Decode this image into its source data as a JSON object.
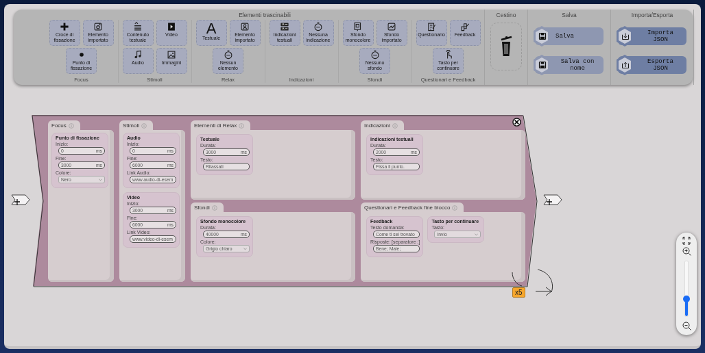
{
  "toolbar": {
    "palette": {
      "title": "Elementi trascinabili",
      "groups": [
        {
          "label": "Focus",
          "items": [
            {
              "label": "Croce di fissazione"
            },
            {
              "label": "Elemento importato"
            },
            {
              "label": "Punto di fissazione"
            }
          ]
        },
        {
          "label": "Stimoli",
          "items": [
            {
              "label": "Contenuto testuale"
            },
            {
              "label": "Video"
            },
            {
              "label": "Audio"
            },
            {
              "label": "Immagini"
            }
          ]
        },
        {
          "label": "Relax",
          "items": [
            {
              "label": "Testuale",
              "glyph": "A"
            },
            {
              "label": "Elemento importato"
            },
            {
              "label": "Nessun elemento"
            }
          ]
        },
        {
          "label": "Indicazioni",
          "items": [
            {
              "label": "Indicazioni testuali"
            },
            {
              "label": "Nessuna indicazione"
            }
          ]
        },
        {
          "label": "Sfondi",
          "items": [
            {
              "label": "Sfondo monocolore"
            },
            {
              "label": "Sfondo importato"
            },
            {
              "label": "Nessuno sfondo"
            }
          ]
        },
        {
          "label": "Questionari e Feedback",
          "items": [
            {
              "label": "Questionario"
            },
            {
              "label": "Feedback"
            },
            {
              "label": "Tasto per continuare"
            }
          ]
        }
      ]
    },
    "trash": {
      "title": "Cestino"
    },
    "save": {
      "title": "Salva",
      "buttons": [
        {
          "label": "Salva"
        },
        {
          "label": "Salva con nome"
        }
      ]
    },
    "import_export": {
      "title": "Importa/Esporta",
      "buttons": [
        {
          "label": "Importa JSON"
        },
        {
          "label": "Esporta JSON"
        }
      ]
    }
  },
  "block": {
    "repeat": "x5",
    "columns": [
      {
        "title": "Focus",
        "cards": [
          {
            "title": "Punto di fissazione",
            "fields": [
              {
                "label": "Inizio:",
                "kind": "number",
                "value": "0",
                "unit": "ms"
              },
              {
                "label": "Fine:",
                "kind": "number",
                "value": "3000",
                "unit": "ms"
              },
              {
                "label": "Colore:",
                "kind": "select",
                "value": "Nero"
              }
            ]
          }
        ]
      },
      {
        "title": "Stimoli",
        "cards": [
          {
            "title": "Audio",
            "fields": [
              {
                "label": "Inizio:",
                "kind": "number",
                "value": "0",
                "unit": "ms"
              },
              {
                "label": "Fine:",
                "kind": "number",
                "value": "6000",
                "unit": "ms"
              },
              {
                "label": "Link Audio:",
                "kind": "text",
                "value": "www.audio-di-esem"
              }
            ]
          },
          {
            "title": "Video",
            "fields": [
              {
                "label": "Inizio:",
                "kind": "number",
                "value": "3000",
                "unit": "ms"
              },
              {
                "label": "Fine:",
                "kind": "number",
                "value": "6000",
                "unit": "ms"
              },
              {
                "label": "Link Video:",
                "kind": "text",
                "value": "www.video-di-esem"
              }
            ]
          }
        ]
      }
    ],
    "panels": [
      {
        "title": "Elementi di Relax",
        "cards": [
          {
            "title": "Testuale",
            "fields": [
              {
                "label": "Durata:",
                "kind": "number",
                "value": "3000",
                "unit": "ms"
              },
              {
                "label": "Testo:",
                "kind": "text",
                "value": "Rilassati"
              }
            ]
          }
        ]
      },
      {
        "title": "Indicazioni",
        "cards": [
          {
            "title": "Indicazioni testuali",
            "fields": [
              {
                "label": "Durata:",
                "kind": "number",
                "value": "2000",
                "unit": "ms"
              },
              {
                "label": "Testo:",
                "kind": "text",
                "value": "Fissa il punto."
              }
            ]
          }
        ]
      },
      {
        "title": "Sfondi",
        "cards": [
          {
            "title": "Sfondo monocolore",
            "fields": [
              {
                "label": "Durata:",
                "kind": "number",
                "value": "40000",
                "unit": "ms"
              },
              {
                "label": "Colore:",
                "kind": "select",
                "value": "Grigio chiaro"
              }
            ]
          }
        ]
      },
      {
        "title": "Questionari e Feedback fine blocco",
        "cards": [
          {
            "title": "Feedback",
            "fields": [
              {
                "label": "Testo domanda:",
                "kind": "text",
                "value": "Come ti sei trovato"
              },
              {
                "label": "Risposte: [separatore ;]",
                "kind": "text",
                "value": "Bene; Male;"
              }
            ]
          },
          {
            "title": "Tasto per continuare",
            "fields": [
              {
                "label": "Tasto:",
                "kind": "select",
                "value": "Invio"
              }
            ]
          }
        ]
      }
    ]
  },
  "zoom": {
    "level": 0.31
  }
}
